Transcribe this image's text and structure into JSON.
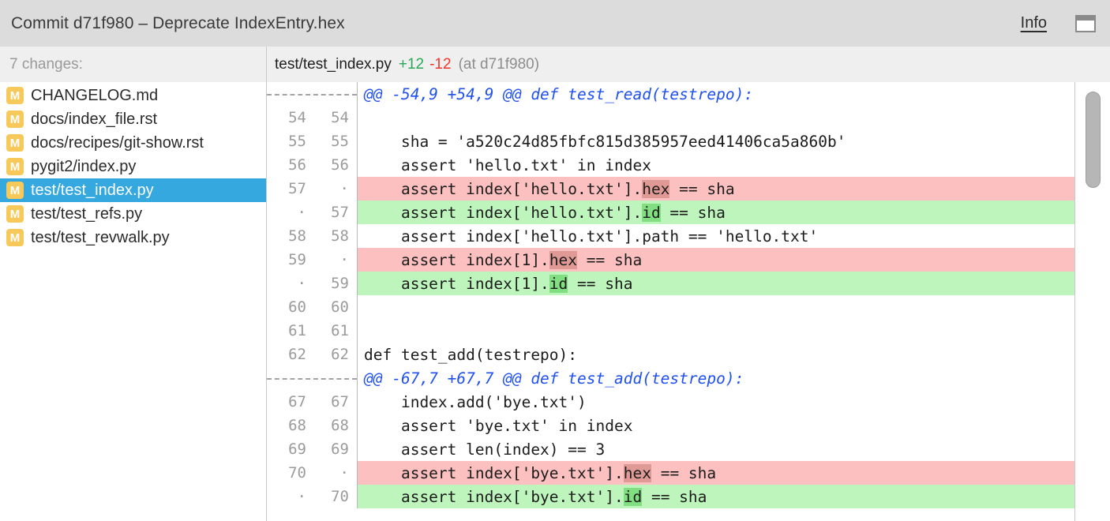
{
  "titlebar": {
    "title": "Commit d71f980 – Deprecate IndexEntry.hex",
    "info_label": "Info",
    "panel_toggle_icon": "panel-toggle-icon"
  },
  "sidebar": {
    "header": "7 changes:",
    "files": [
      {
        "status": "M",
        "name": "CHANGELOG.md",
        "selected": false
      },
      {
        "status": "M",
        "name": "docs/index_file.rst",
        "selected": false
      },
      {
        "status": "M",
        "name": "docs/recipes/git-show.rst",
        "selected": false
      },
      {
        "status": "M",
        "name": "pygit2/index.py",
        "selected": false
      },
      {
        "status": "M",
        "name": "test/test_index.py",
        "selected": true
      },
      {
        "status": "M",
        "name": "test/test_refs.py",
        "selected": false
      },
      {
        "status": "M",
        "name": "test/test_revwalk.py",
        "selected": false
      }
    ]
  },
  "diff": {
    "file": "test/test_index.py",
    "additions": "+12",
    "deletions": "-12",
    "at_commit": "(at d71f980)",
    "lines": [
      {
        "type": "hunk",
        "old": "",
        "new": "",
        "text": "@@ -54,9 +54,9 @@ def test_read(testrepo):"
      },
      {
        "type": "ctx",
        "old": "54",
        "new": "54",
        "text": ""
      },
      {
        "type": "ctx",
        "old": "55",
        "new": "55",
        "text": "    sha = 'a520c24d85fbfc815d385957eed41406ca5a860b'"
      },
      {
        "type": "ctx",
        "old": "56",
        "new": "56",
        "text": "    assert 'hello.txt' in index"
      },
      {
        "type": "del",
        "old": "57",
        "new": "·",
        "pre": "    assert index['hello.txt'].",
        "word": "hex",
        "post": " == sha"
      },
      {
        "type": "add",
        "old": "·",
        "new": "57",
        "pre": "    assert index['hello.txt'].",
        "word": "id",
        "post": " == sha"
      },
      {
        "type": "ctx",
        "old": "58",
        "new": "58",
        "text": "    assert index['hello.txt'].path == 'hello.txt'"
      },
      {
        "type": "del",
        "old": "59",
        "new": "·",
        "pre": "    assert index[1].",
        "word": "hex",
        "post": " == sha"
      },
      {
        "type": "add",
        "old": "·",
        "new": "59",
        "pre": "    assert index[1].",
        "word": "id",
        "post": " == sha"
      },
      {
        "type": "ctx",
        "old": "60",
        "new": "60",
        "text": ""
      },
      {
        "type": "ctx",
        "old": "61",
        "new": "61",
        "text": ""
      },
      {
        "type": "ctx",
        "old": "62",
        "new": "62",
        "text": "def test_add(testrepo):"
      },
      {
        "type": "hunk",
        "old": "",
        "new": "",
        "text": "@@ -67,7 +67,7 @@ def test_add(testrepo):"
      },
      {
        "type": "ctx",
        "old": "67",
        "new": "67",
        "text": "    index.add('bye.txt')"
      },
      {
        "type": "ctx",
        "old": "68",
        "new": "68",
        "text": "    assert 'bye.txt' in index"
      },
      {
        "type": "ctx",
        "old": "69",
        "new": "69",
        "text": "    assert len(index) == 3"
      },
      {
        "type": "del",
        "old": "70",
        "new": "·",
        "pre": "    assert index['bye.txt'].",
        "word": "hex",
        "post": " == sha"
      },
      {
        "type": "add",
        "old": "·",
        "new": "70",
        "pre": "    assert index['bye.txt'].",
        "word": "id",
        "post": " == sha"
      }
    ]
  },
  "colors": {
    "titlebar_bg": "#dcdcdc",
    "subheader_bg": "#efefef",
    "selection_blue": "#36a8e0",
    "status_badge": "#f7c95a",
    "added_line": "#bdf5bd",
    "removed_line": "#fbc0bf",
    "added_word": "#81de81",
    "removed_word": "#e09a96",
    "hunk_blue": "#2050f0",
    "add_count_green": "#2aa858",
    "del_count_red": "#f0362b"
  }
}
